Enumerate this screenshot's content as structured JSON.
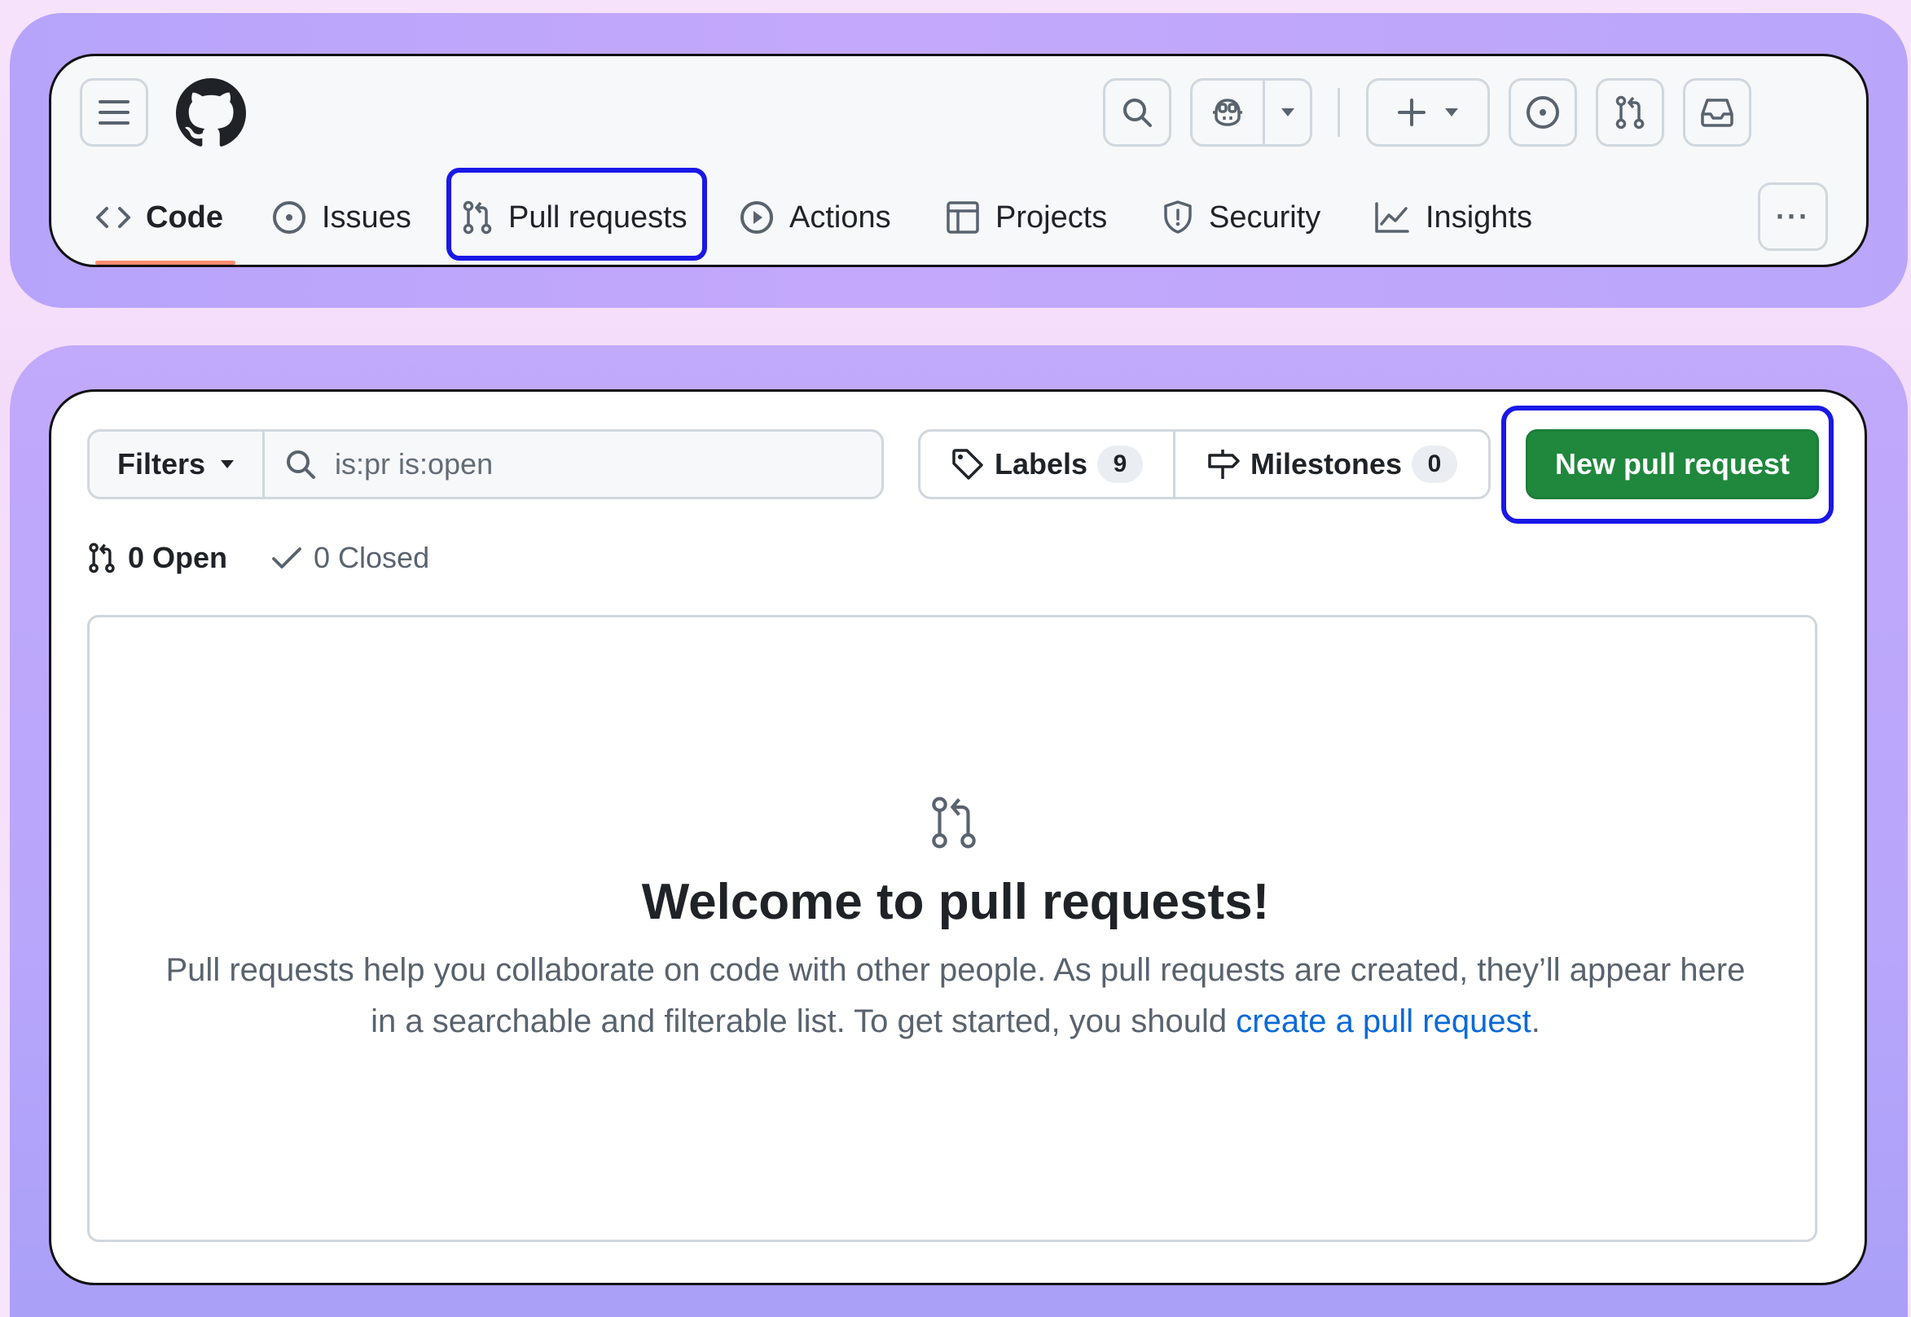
{
  "nav": {
    "tabs": [
      {
        "label": "Code",
        "icon": "code-icon",
        "selected": true
      },
      {
        "label": "Issues",
        "icon": "issue-opened-icon"
      },
      {
        "label": "Pull requests",
        "icon": "git-pull-request-icon",
        "highlighted": true
      },
      {
        "label": "Actions",
        "icon": "play-icon"
      },
      {
        "label": "Projects",
        "icon": "table-icon"
      },
      {
        "label": "Security",
        "icon": "shield-icon"
      },
      {
        "label": "Insights",
        "icon": "graph-icon"
      }
    ],
    "more_label": "···"
  },
  "toolbar": {
    "filters_label": "Filters",
    "search_value": "is:pr is:open",
    "labels_label": "Labels",
    "labels_count": "9",
    "milestones_label": "Milestones",
    "milestones_count": "0",
    "new_pr_label": "New pull request"
  },
  "states": {
    "open_label": "0 Open",
    "closed_label": "0 Closed"
  },
  "blankslate": {
    "title": "Welcome to pull requests!",
    "text_before": "Pull requests help you collaborate on code with other people. As pull requests are created, they’ll appear here in a searchable and filterable list. To get started, you should ",
    "link_text": "create a pull request",
    "text_after": "."
  },
  "colors": {
    "primary_button": "#1f883d",
    "highlight_outline": "#1a18e6",
    "link": "#0969da",
    "selected_underline": "#fd8c73"
  }
}
